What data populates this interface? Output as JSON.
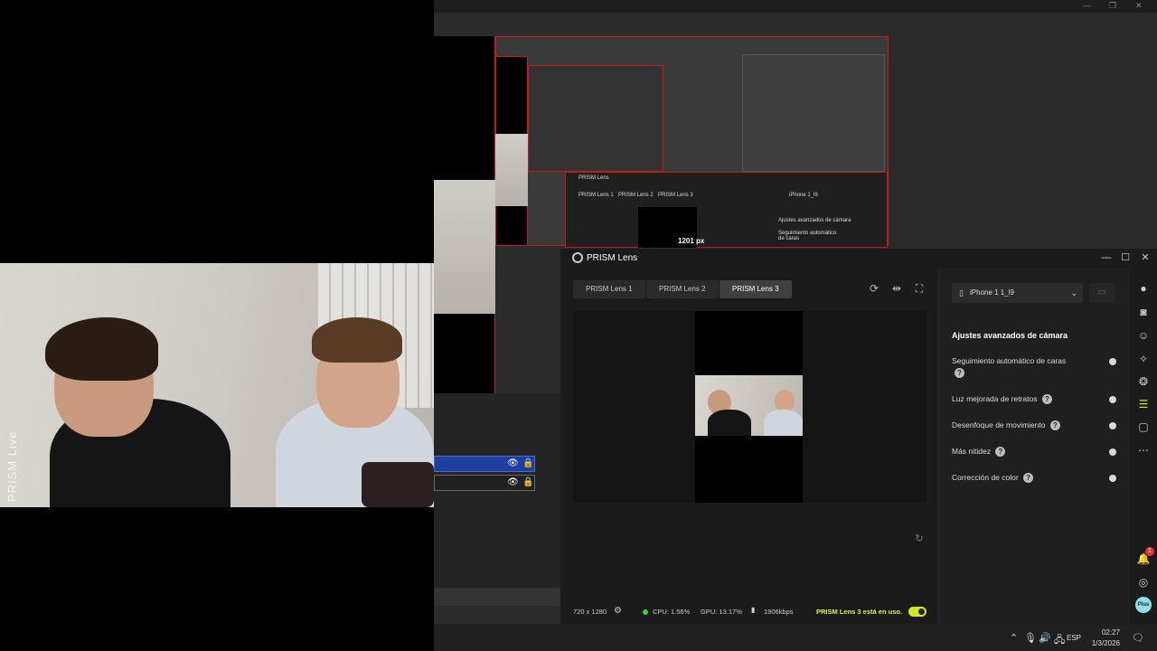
{
  "camera_output": {
    "watermark": "PRISM Live"
  },
  "mini_lens": {
    "title": "PRISM Lens",
    "tabs": [
      "PRISM Lens 1",
      "PRISM Lens 2",
      "PRISM Lens 3"
    ],
    "device": "iPhone 1_l9",
    "heading": "Ajustes avanzados de cámara",
    "setting": "Seguimiento automático de caras",
    "resolution_label": "1201 px"
  },
  "lens": {
    "title": "PRISM Lens",
    "tabs": [
      {
        "label": "PRISM Lens 1",
        "active": false
      },
      {
        "label": "PRISM Lens 2",
        "active": false
      },
      {
        "label": "PRISM Lens 3",
        "active": true
      }
    ],
    "device": {
      "selected": "iPhone 1 1_l9"
    },
    "settings_heading": "Ajustes avanzados de cámara",
    "settings": [
      {
        "label": "Seguimiento automático de caras",
        "enabled": false
      },
      {
        "label": "Luz mejorada de retratos",
        "enabled": false
      },
      {
        "label": "Desenfoque de movimiento",
        "enabled": false
      },
      {
        "label": "Más nitidez",
        "enabled": false
      },
      {
        "label": "Corrección de color",
        "enabled": false
      }
    ],
    "status": {
      "resolution": "720 x 1280",
      "cpu": "CPU: 1.56%",
      "gpu": "GPU: 13.17%",
      "bitrate": "1906kbps",
      "in_use": "PRISM Lens 3 está en uso.",
      "in_use_toggle": true
    },
    "notification_count": "1",
    "plus_label": "Plus"
  },
  "taskbar": {
    "language": "ESP",
    "time": "02:27",
    "date": "1/3/2026"
  },
  "colors": {
    "accent": "#d8e524",
    "recording_border": "#c41a1a",
    "selection_blue": "#1f3f9e",
    "cpu_ok": "#3ecf3e"
  }
}
